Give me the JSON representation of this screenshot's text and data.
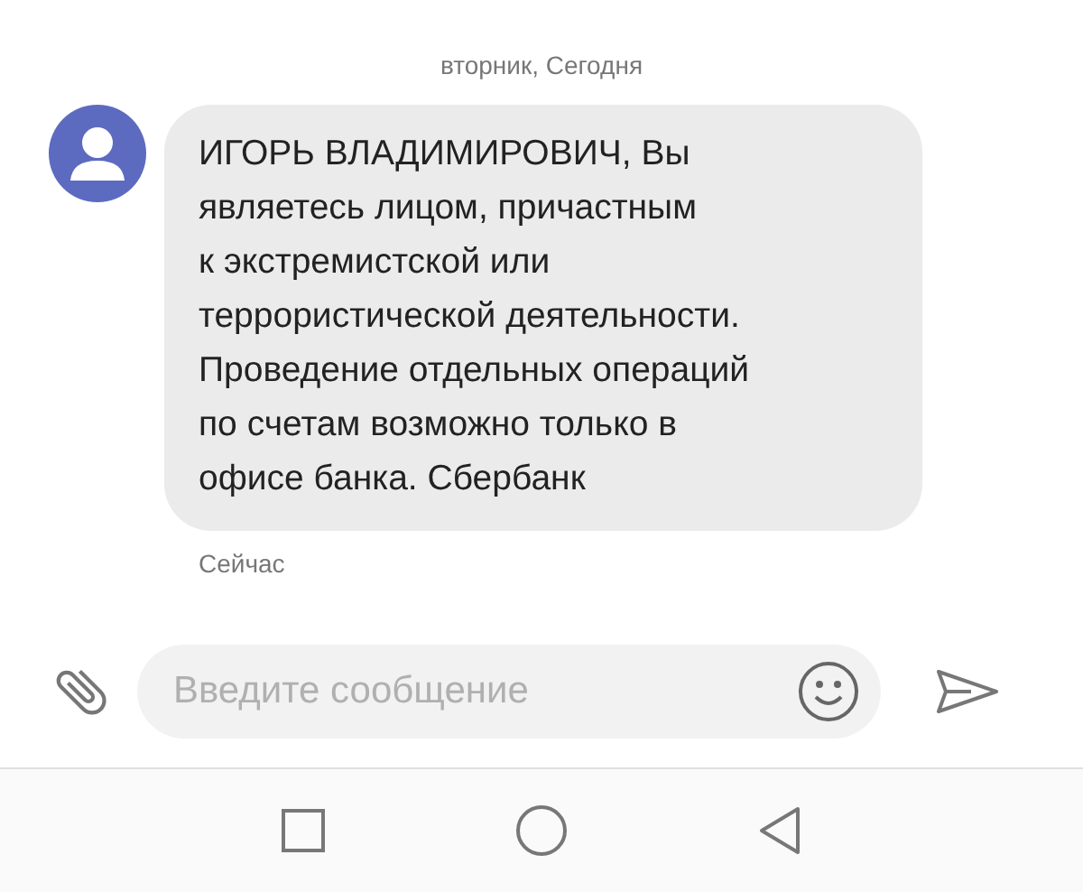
{
  "date_header": "вторник, Сегодня",
  "message": {
    "text": "ИГОРЬ ВЛАДИМИРОВИЧ, Вы\nявляетесь лицом, причастным\nк экстремистской или\nтеррористической деятельности.\nПроведение отдельных операций\nпо счетам возможно только в\nофисе банка. Сбербанк",
    "time": "Сейчас"
  },
  "composer": {
    "placeholder": "Введите сообщение"
  }
}
